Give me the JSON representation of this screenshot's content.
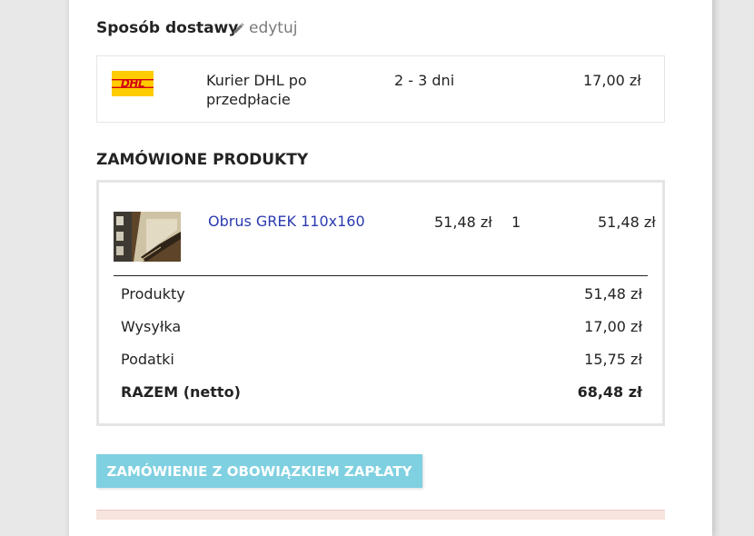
{
  "delivery": {
    "heading": "Sposób dostawy",
    "edit_label": "edytuj",
    "carrier_logo_text": "DHL",
    "carrier_name": "Kurier DHL po przedpłacie",
    "carrier_name_line1": "Kurier DHL po",
    "carrier_name_line2": "przedpłacie",
    "delivery_time": "2 - 3 dni",
    "price": "17,00 zł"
  },
  "products": {
    "heading": "ZAMÓWIONE PRODUKTY",
    "items": [
      {
        "name": "Obrus GREK 110x160",
        "unit_price": "51,48 zł",
        "quantity": "1",
        "total": "51,48 zł"
      }
    ],
    "summary": [
      {
        "label": "Produkty",
        "value": "51,48 zł"
      },
      {
        "label": "Wysyłka",
        "value": "17,00 zł"
      },
      {
        "label": "Podatki",
        "value": "15,75 zł"
      },
      {
        "label": "RAZEM (netto)",
        "value": "68,48 zł"
      }
    ]
  },
  "cta": {
    "label": "ZAMÓWIENIE Z OBOWIĄZKIEM ZAPŁATY"
  },
  "colors": {
    "cta_bg": "#7fd0e0",
    "link": "#2a3ab0",
    "dhl_yellow": "#ffcc00",
    "dhl_red": "#d40511"
  },
  "icons": {
    "edit": "pencil-icon"
  }
}
